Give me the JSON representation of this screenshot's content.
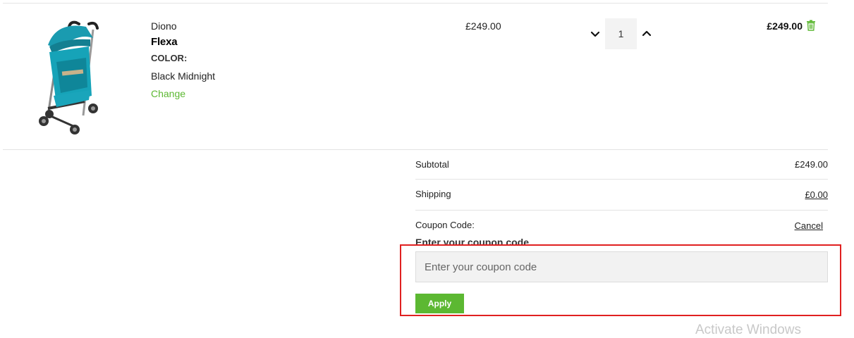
{
  "cart_item": {
    "image_icon": "stroller-product-image",
    "brand": "Diono",
    "model": "Flexa",
    "color_label": "COLOR:",
    "color_value": "Black Midnight",
    "change_link": "Change",
    "unit_price": "£249.00",
    "quantity": "1",
    "line_total": "£249.00",
    "delete_icon": "trash-icon"
  },
  "summary": {
    "subtotal_label": "Subtotal",
    "subtotal_value": "£249.00",
    "shipping_label": "Shipping",
    "shipping_value": "£0.00",
    "coupon_label": "Coupon Code:",
    "cancel_link": "Cancel"
  },
  "coupon": {
    "title": "Enter your coupon code",
    "placeholder": "Enter your coupon code",
    "value": "",
    "apply_label": "Apply"
  },
  "watermark": "Activate Windows",
  "colors": {
    "accent_green": "#5cb832",
    "highlight_red": "#e02020",
    "input_bg": "#f2f2f2"
  }
}
